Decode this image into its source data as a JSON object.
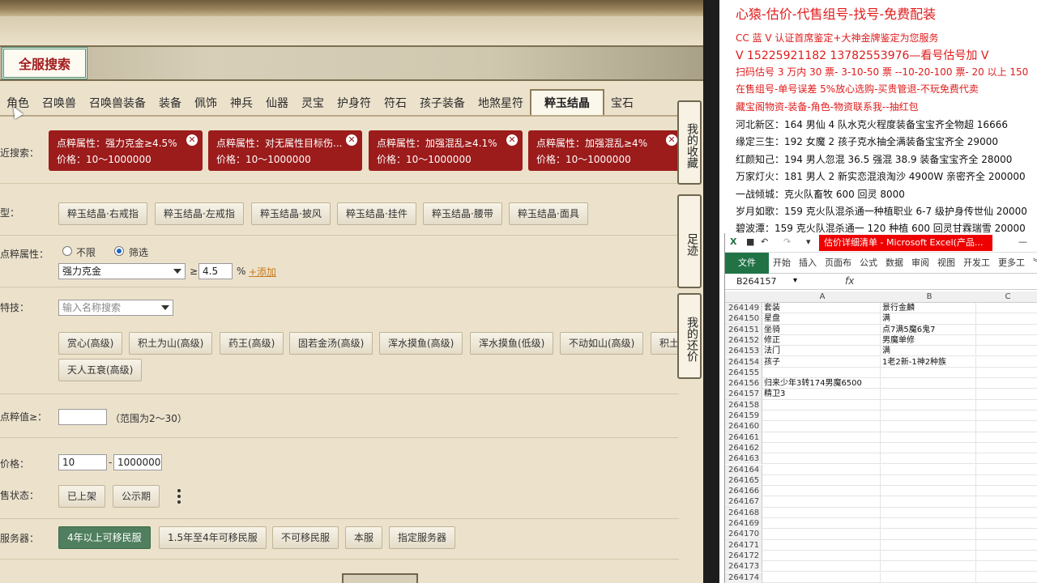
{
  "game": {
    "title": "全服搜索",
    "tabs": [
      "角色",
      "召唤兽",
      "召唤兽装备",
      "装备",
      "佩饰",
      "神兵",
      "仙器",
      "灵宝",
      "护身符",
      "符石",
      "孩子装备",
      "地煞星符",
      "粹玉结晶",
      "宝石"
    ],
    "active_tab": "粹玉结晶",
    "recent_label": "近搜索：",
    "chips": [
      {
        "line1": "点粹属性：强力克金≥4.5%",
        "line2": "价格：10～1000000"
      },
      {
        "line1": "点粹属性：对无属性目标伤...",
        "line2": "价格：10～1000000"
      },
      {
        "line1": "点粹属性：加强混乱≥4.1%",
        "line2": "价格：10～1000000"
      },
      {
        "line1": "点粹属性：加强混乱≥4%",
        "line2": "价格：10～1000000"
      }
    ],
    "type_label": "型：",
    "type_buttons": [
      "粹玉结晶·右戒指",
      "粹玉结晶·左戒指",
      "粹玉结晶·披风",
      "粹玉结晶·挂件",
      "粹玉结晶·腰带",
      "粹玉结晶·面具"
    ],
    "attr_label": "点粹属性：",
    "radio_unlimited": "不限",
    "radio_filter": "筛选",
    "attr_select": "强力克金",
    "ge": "≥",
    "attr_value": "4.5",
    "percent": "%",
    "add_link": "+添加",
    "skill_label": "特技：",
    "skill_placeholder": "输入名称搜索",
    "skill_buttons_row1": [
      "赏心(高级)",
      "积土为山(高级)",
      "药王(高级)",
      "固若金汤(高级)",
      "浑水摸鱼(高级)",
      "浑水摸鱼(低级)",
      "不动如山(高级)",
      "积土"
    ],
    "skill_buttons_row2": [
      "天人五衰(高级)"
    ],
    "total_label": "点粹值≥：",
    "total_hint": "（范围为2～30）",
    "price_label": "价格：",
    "price_min": "10",
    "price_dash": "-",
    "price_max": "1000000",
    "sale_label": "售状态：",
    "sale_buttons": [
      "已上架",
      "公示期"
    ],
    "server_label": "服务器：",
    "server_buttons": [
      "4年以上可移民服",
      "1.5年至4年可移民服",
      "不可移民服",
      "本服",
      "指定服务器"
    ],
    "side_tabs": [
      "我的收藏",
      "足迹",
      "我的还价"
    ]
  },
  "notes": {
    "headline": "心猿-估价-代售组号-找号-免费配装",
    "red_lines": [
      "CC 蓝 V 认证首席鉴定+大神金牌鉴定为您服务",
      "V 15225921182      13782553976—看号估号加 V",
      "扫码估号 3 万内 30 票- 3-10-50 票  --10-20-100 票- 20 以上 150",
      "在售组号-单号误差 5%放心选购-买贵管退-不玩免费代卖",
      "藏宝阁物资-装备-角色-物资联系我--抽红包"
    ],
    "black_lines": [
      "河北新区：164 男仙 4 队水克火程度装备宝宝齐全物超 16666",
      "缘定三生：192 女魔 2 孩子克水抽全满装备宝宝齐全 29000",
      "红颜知己：194 男人忽混 36.5 强混 38.9 装备宝宝齐全 28000",
      "万家灯火：181 男人 2 新实恋混浪淘沙 4900W 亲密齐全 200000",
      "一战倾城：克火队畜牧 600 回灵 8000",
      "岁月如歌：159 克火队混杀通一种植职业 6-7 级护身传世仙 20000",
      "碧波潭：159 克火队混杀通一 120 种植 600 回灵甘霖瑞雪 20000"
    ]
  },
  "excel": {
    "doc_title": "估价详细清单 - Microsoft Excel(产品...",
    "ribbon_tabs": [
      "文件",
      "开始",
      "插入",
      "页面布",
      "公式",
      "数据",
      "审阅",
      "视图",
      "开发工",
      "更多工"
    ],
    "name_box": "B264157",
    "fx": "fx",
    "columns": [
      "A",
      "B",
      "C"
    ],
    "rows": [
      {
        "n": "264149",
        "a": "套装",
        "b": "景行金麟"
      },
      {
        "n": "264150",
        "a": "星盘",
        "b": "满"
      },
      {
        "n": "264151",
        "a": "坐骑",
        "b": "点7满5魔6鬼7"
      },
      {
        "n": "264152",
        "a": "修正",
        "b": "男魔单修"
      },
      {
        "n": "264153",
        "a": "法门",
        "b": "满"
      },
      {
        "n": "264154",
        "a": "孩子",
        "b": "1老2新-1神2种族"
      },
      {
        "n": "264155",
        "a": "",
        "b": ""
      },
      {
        "n": "264156",
        "a": "归来少年3转174男魔6500",
        "b": ""
      },
      {
        "n": "264157",
        "a": "精卫3",
        "b": ""
      },
      {
        "n": "264158",
        "a": "",
        "b": ""
      },
      {
        "n": "264159",
        "a": "",
        "b": ""
      },
      {
        "n": "264160",
        "a": "",
        "b": ""
      },
      {
        "n": "264161",
        "a": "",
        "b": ""
      },
      {
        "n": "264162",
        "a": "",
        "b": ""
      },
      {
        "n": "264163",
        "a": "",
        "b": ""
      },
      {
        "n": "264164",
        "a": "",
        "b": ""
      },
      {
        "n": "264165",
        "a": "",
        "b": ""
      },
      {
        "n": "264166",
        "a": "",
        "b": ""
      },
      {
        "n": "264167",
        "a": "",
        "b": ""
      },
      {
        "n": "264168",
        "a": "",
        "b": ""
      },
      {
        "n": "264169",
        "a": "",
        "b": ""
      },
      {
        "n": "264170",
        "a": "",
        "b": ""
      },
      {
        "n": "264171",
        "a": "",
        "b": ""
      },
      {
        "n": "264172",
        "a": "",
        "b": ""
      },
      {
        "n": "264173",
        "a": "",
        "b": ""
      },
      {
        "n": "264174",
        "a": "",
        "b": ""
      }
    ]
  },
  "colors": {
    "chip_red": "#9c1b1b",
    "accent_green": "#4f7f5e",
    "notes_red": "#e01b1b",
    "excel_green": "#217346"
  }
}
